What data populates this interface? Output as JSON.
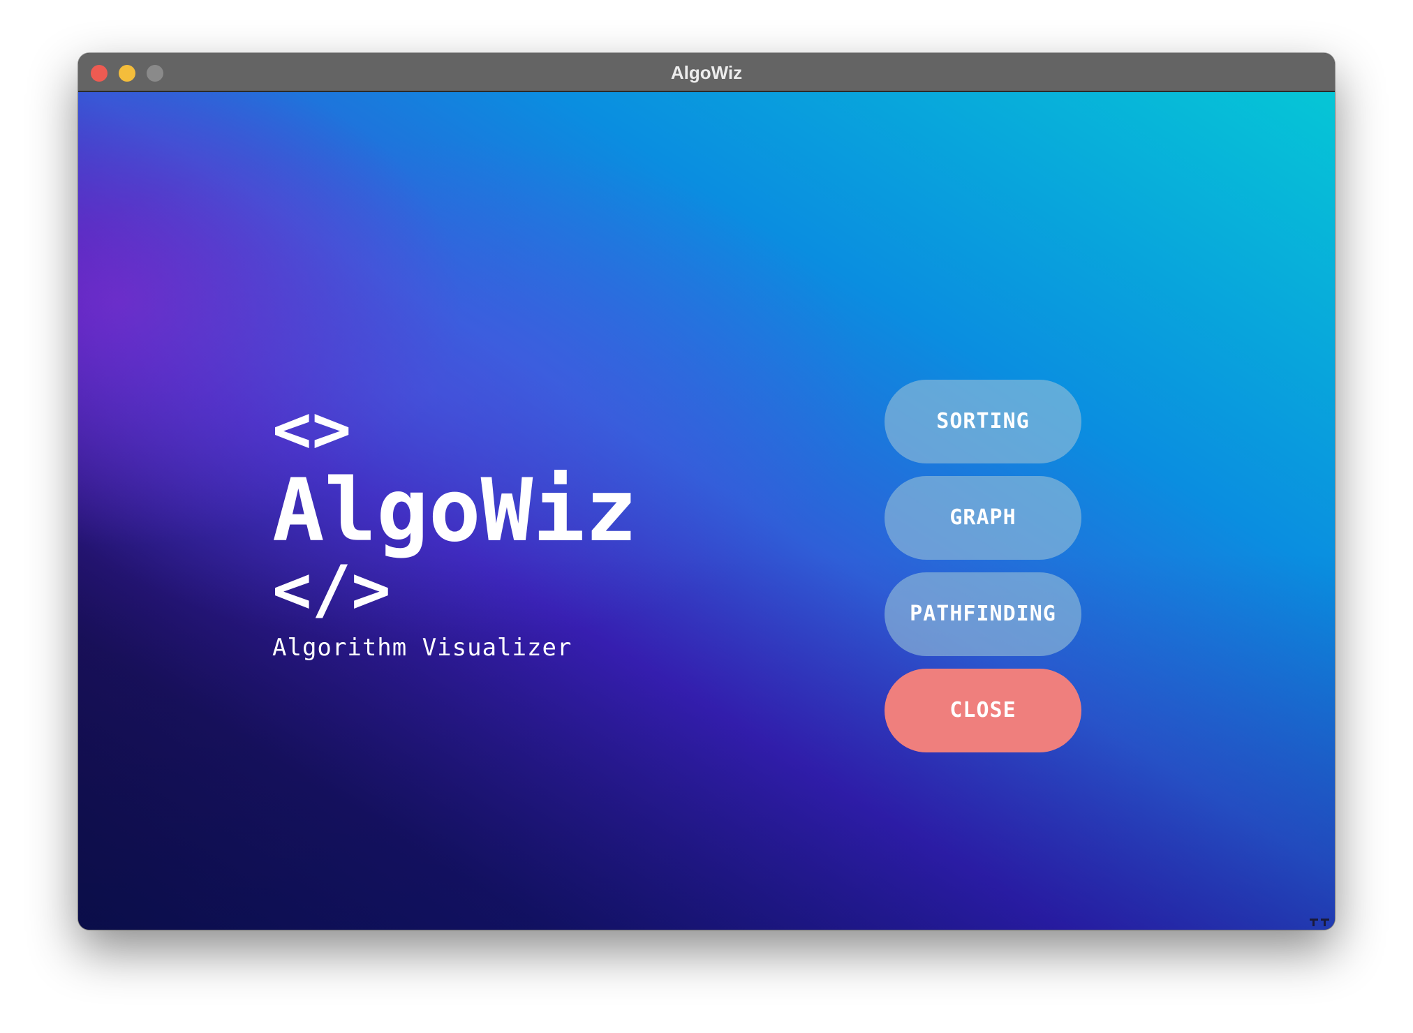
{
  "window": {
    "title": "AlgoWiz"
  },
  "brand": {
    "tag_open": "<>",
    "name": "AlgoWiz",
    "tag_close": "</>",
    "subtitle": "Algorithm Visualizer"
  },
  "menu": {
    "sorting_label": "SORTING",
    "graph_label": "GRAPH",
    "pathfinding_label": "PATHFINDING",
    "close_label": "CLOSE"
  },
  "colors": {
    "close_button": "#ef7f7d",
    "menu_button": "#96bed7",
    "titlebar": "#646464"
  }
}
